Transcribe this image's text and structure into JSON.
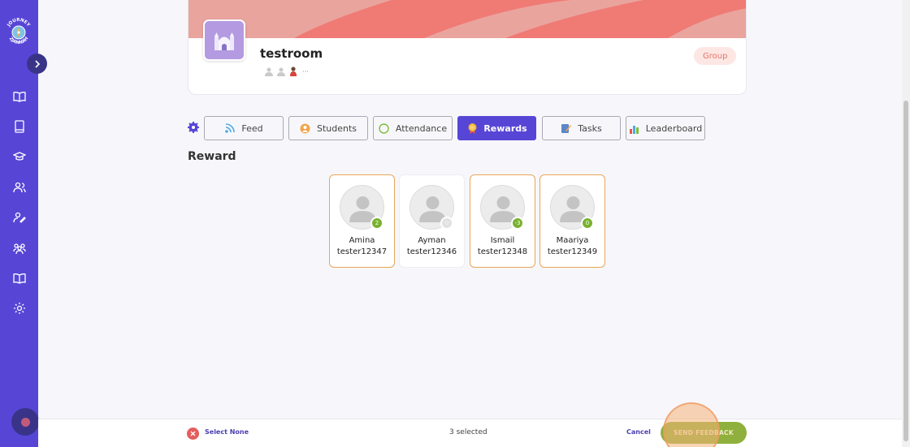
{
  "sidebar": {
    "logo_lines": [
      "JOURNEY",
      "2JANNAH"
    ],
    "items": [
      {
        "icon": "book-open-icon"
      },
      {
        "icon": "book-icon"
      },
      {
        "icon": "graduation-cap-icon"
      },
      {
        "icon": "users-icon"
      },
      {
        "icon": "user-edit-icon"
      },
      {
        "icon": "group-icon"
      },
      {
        "icon": "book-open-icon"
      },
      {
        "icon": "gear-icon"
      }
    ]
  },
  "room": {
    "name": "testroom",
    "type_badge": "Group",
    "more_members": "···"
  },
  "tabs": [
    {
      "label": "Feed",
      "icon": "rss-icon"
    },
    {
      "label": "Students",
      "icon": "student-icon"
    },
    {
      "label": "Attendance",
      "icon": "circle-icon"
    },
    {
      "label": "Rewards",
      "icon": "award-icon",
      "active": true
    },
    {
      "label": "Tasks",
      "icon": "tasks-icon"
    },
    {
      "label": "Leaderboard",
      "icon": "bar-chart-icon"
    }
  ],
  "section": {
    "title": "Reward"
  },
  "students": [
    {
      "name": "Amina",
      "username": "tester12347",
      "score": "2",
      "selected": true
    },
    {
      "name": "Ayman",
      "username": "tester12346",
      "score": "0",
      "selected": false
    },
    {
      "name": "Ismail",
      "username": "tester12348",
      "score": "-3",
      "selected": true
    },
    {
      "name": "Maariya",
      "username": "tester12349",
      "score": "0",
      "selected": true
    }
  ],
  "bottom": {
    "select_none": "Select None",
    "selected_count": "3 selected",
    "cancel": "Cancel",
    "send_feedback": "SEND FEEDBACK"
  },
  "colors": {
    "sidebar": "#5746d6",
    "accent": "#5746d6",
    "selected_border": "#e9a55a",
    "score_green": "#78b22e",
    "send_button": "#8fb03c",
    "banner": "#f07a74"
  }
}
